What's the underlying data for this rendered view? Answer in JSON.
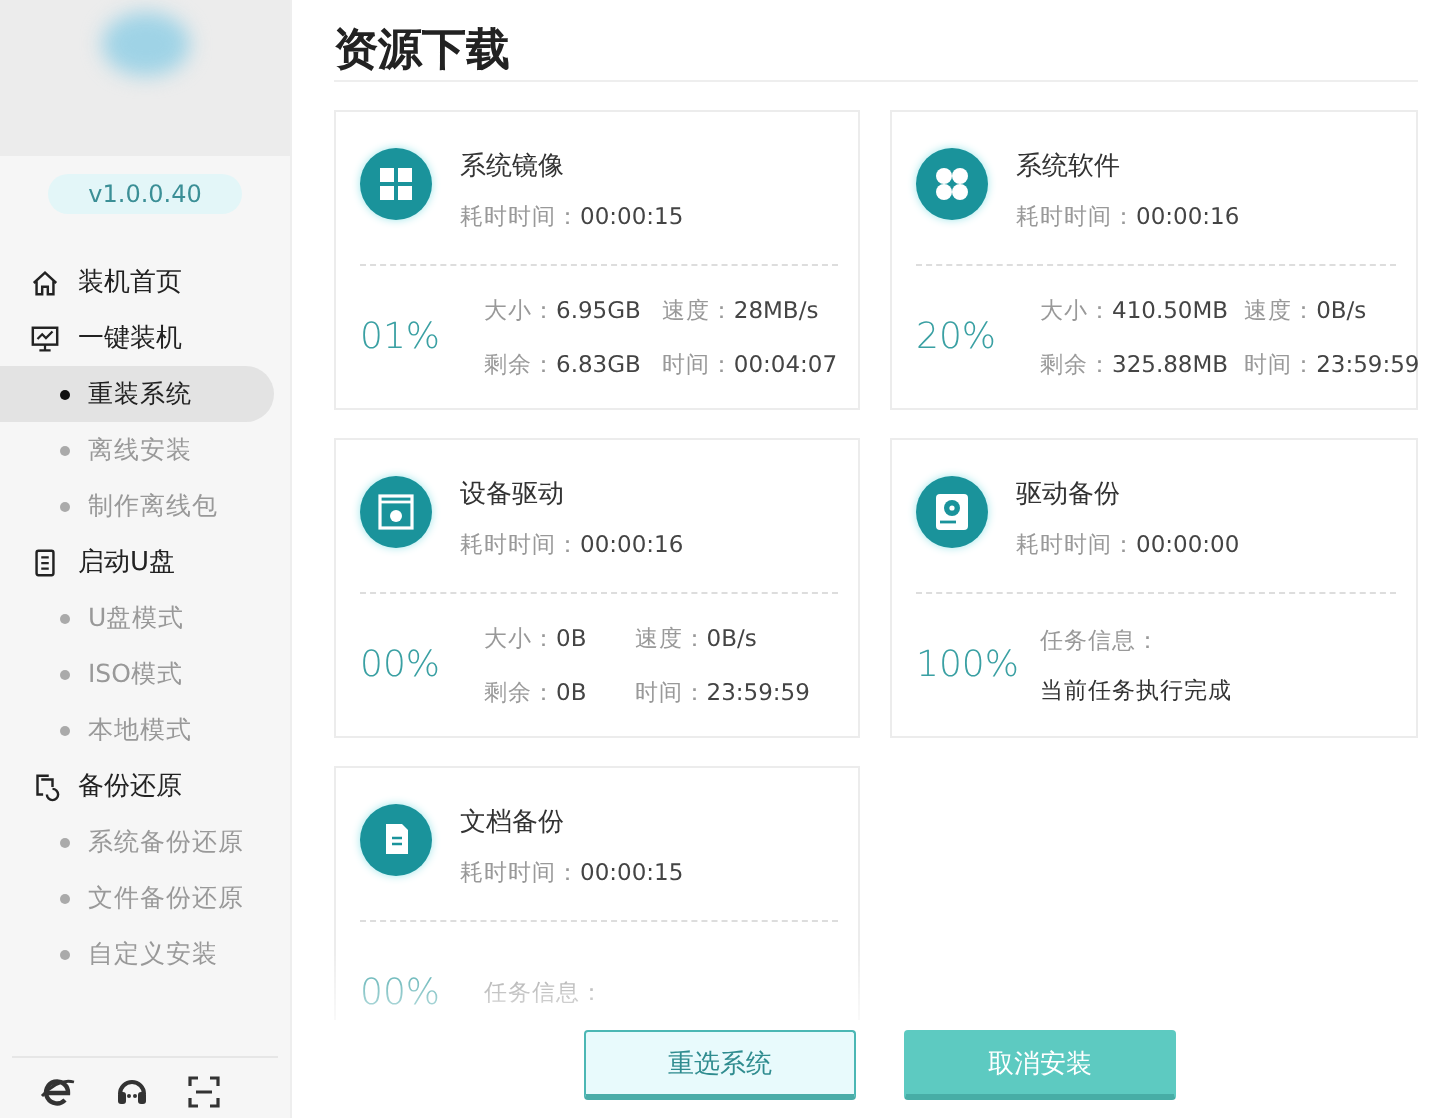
{
  "sidebar": {
    "version": "v1.0.0.40",
    "groups": [
      {
        "label": "装机首页"
      },
      {
        "label": "一键装机",
        "items": [
          {
            "label": "重装系统",
            "selected": true
          },
          {
            "label": "离线安装",
            "selected": false
          },
          {
            "label": "制作离线包",
            "selected": false
          }
        ]
      },
      {
        "label": "启动U盘",
        "items": [
          {
            "label": "U盘模式",
            "selected": false
          },
          {
            "label": "ISO模式",
            "selected": false
          },
          {
            "label": "本地模式",
            "selected": false
          }
        ]
      },
      {
        "label": "备份还原",
        "items": [
          {
            "label": "系统备份还原",
            "selected": false
          },
          {
            "label": "文件备份还原",
            "selected": false
          },
          {
            "label": "自定义安装",
            "selected": false
          }
        ]
      }
    ]
  },
  "page": {
    "title": "资源下载"
  },
  "cards": [
    {
      "kind": "stats",
      "name": "系统镜像",
      "elapsed_label": "耗时时间：",
      "elapsed": "00:00:15",
      "percent": "01%",
      "size": "大小：",
      "size_value": "6.95GB",
      "speed": "速度：",
      "speed_value": "28MB/s",
      "remaining": "剩余：",
      "remaining_value": "6.83GB",
      "time": "时间：",
      "time_value": "00:04:07"
    },
    {
      "kind": "stats",
      "name": "系统软件",
      "elapsed_label": "耗时时间：",
      "elapsed": "00:00:16",
      "percent": "20%",
      "size": "大小：",
      "size_value": "410.50MB",
      "speed": "速度：",
      "speed_value": "0B/s",
      "remaining": "剩余：",
      "remaining_value": "325.88MB",
      "time": "时间：",
      "time_value": "23:59:59"
    },
    {
      "kind": "stats",
      "name": "设备驱动",
      "elapsed_label": "耗时时间：",
      "elapsed": "00:00:16",
      "percent": "00%",
      "size": "大小：",
      "size_value": "0B",
      "speed": "速度：",
      "speed_value": "0B/s",
      "remaining": "剩余：",
      "remaining_value": "0B",
      "time": "时间：",
      "time_value": "23:59:59"
    },
    {
      "kind": "task",
      "name": "驱动备份",
      "elapsed_label": "耗时时间：",
      "elapsed": "00:00:00",
      "percent": "100%",
      "info_label": "任务信息：",
      "info": "当前任务执行完成"
    },
    {
      "kind": "task",
      "name": "文档备份",
      "elapsed_label": "耗时时间：",
      "elapsed": "00:00:15",
      "percent": "00%",
      "info_label": "任务信息："
    }
  ],
  "buttons": [
    {
      "label": "重选系统",
      "kind": "secondary"
    },
    {
      "label": "取消安装",
      "kind": "primary"
    }
  ]
}
